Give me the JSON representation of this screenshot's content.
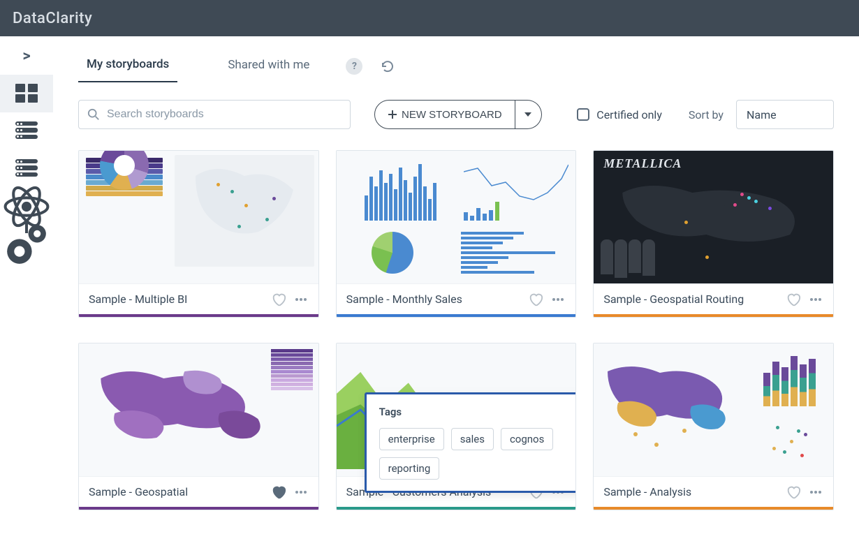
{
  "app": {
    "name": "DataClarity"
  },
  "sidebar": {
    "expand_glyph": ">",
    "items": [
      {
        "id": "storyboards",
        "active": true
      },
      {
        "id": "datasets"
      },
      {
        "id": "connections"
      },
      {
        "id": "science"
      },
      {
        "id": "settings"
      }
    ]
  },
  "tabs": {
    "my": "My storyboards",
    "shared": "Shared with me"
  },
  "toolbar": {
    "search_placeholder": "Search storyboards",
    "new_label": "NEW STORYBOARD",
    "certified_label": "Certified only",
    "sort_label": "Sort by",
    "sort_value": "Name"
  },
  "cards": [
    {
      "title": "Sample - Multiple BI",
      "accent": "acc-purple",
      "fav": false,
      "preview": "multibi"
    },
    {
      "title": "Sample - Monthly Sales",
      "accent": "acc-blue",
      "fav": false,
      "preview": "monthly"
    },
    {
      "title": "Sample - Geospatial Routing",
      "accent": "acc-orange",
      "fav": false,
      "preview": "routing"
    },
    {
      "title": "Sample - Geospatial",
      "accent": "acc-purple",
      "fav": true,
      "preview": "geo"
    },
    {
      "title": "Sample - Customers Analysis",
      "accent": "acc-teal",
      "fav": false,
      "preview": "customers",
      "show_tags": true
    },
    {
      "title": "Sample - Analysis",
      "accent": "acc-orange",
      "fav": false,
      "preview": "analysis"
    }
  ],
  "tags_popup": {
    "title": "Tags",
    "items": [
      "enterprise",
      "sales",
      "cognos",
      "reporting"
    ]
  },
  "colors": {
    "header": "#3f4a55",
    "accent_purple": "#6b3a8a",
    "accent_blue": "#3a7ad0",
    "accent_orange": "#e88a2a",
    "accent_teal": "#2a9a8a"
  }
}
